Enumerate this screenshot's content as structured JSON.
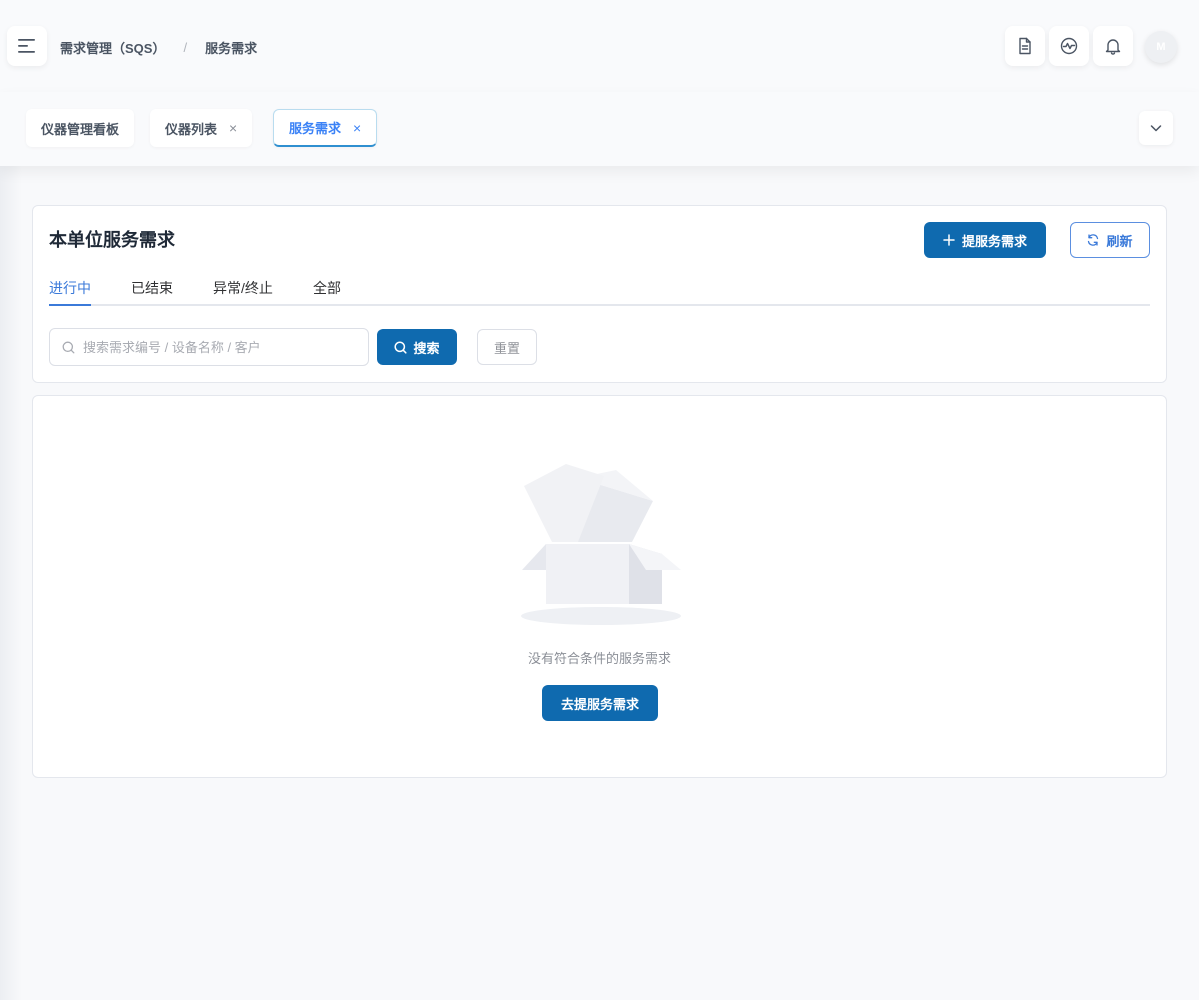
{
  "breadcrumb": {
    "module": "需求管理（SQS）",
    "separator": "/",
    "current": "服务需求"
  },
  "header": {
    "avatar_initial": "M",
    "icons": [
      "menu-fold-icon",
      "document-icon",
      "activity-icon",
      "bell-icon"
    ]
  },
  "page_tabs": [
    {
      "label": "仪器管理看板"
    },
    {
      "label": "仪器列表",
      "close": "×"
    },
    {
      "label": "服务需求",
      "close": "×"
    }
  ],
  "card": {
    "title": "本单位服务需求",
    "new_button": "提服务需求",
    "refresh_button": "刷新"
  },
  "status_tabs": [
    "进行中",
    "已结束",
    "异常/终止",
    "全部"
  ],
  "search": {
    "placeholder": "搜索需求编号 / 设备名称 / 客户",
    "value": "",
    "search_button": "搜索",
    "reset_button": "重置"
  },
  "empty": {
    "message": "没有符合条件的服务需求",
    "action_button": "去提服务需求"
  },
  "colors": {
    "primary": "#0f6aaf",
    "active_tab": "#3b82f6",
    "outline": "#5b8fe0"
  }
}
